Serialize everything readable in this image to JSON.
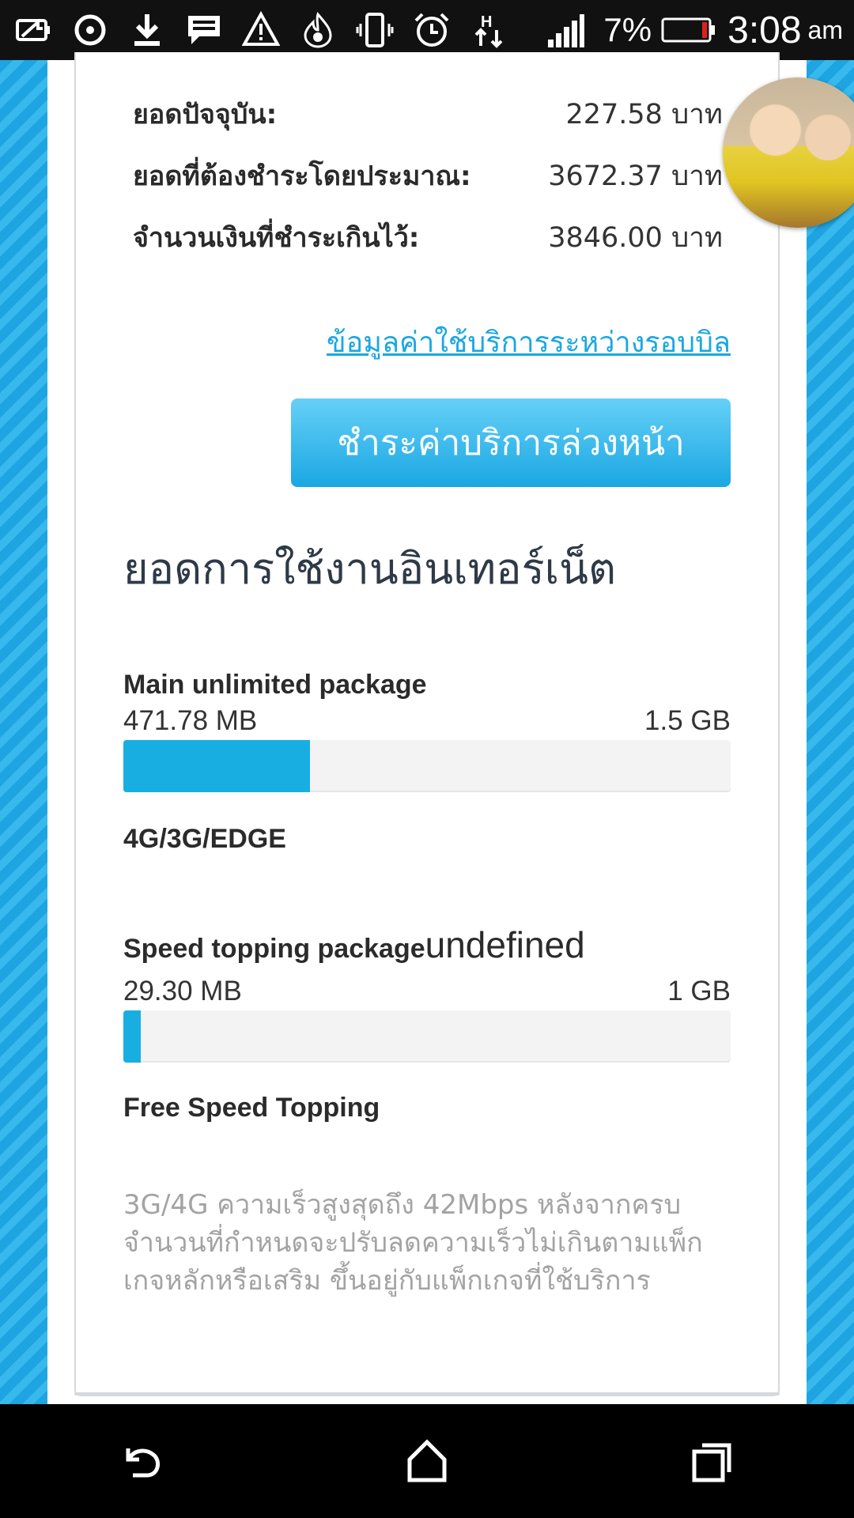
{
  "status_bar": {
    "battery_percent": "7%",
    "time": "3:08",
    "ampm": "am",
    "icons": [
      "battery-saver-icon",
      "sync-icon",
      "download-icon",
      "message-icon",
      "warning-icon",
      "flame-icon",
      "vibrate-icon",
      "alarm-icon",
      "hspa-data-icon",
      "signal-icon",
      "battery-icon"
    ]
  },
  "balances": [
    {
      "label": "ยอดปัจจุบัน:",
      "value": "227.58 บาท"
    },
    {
      "label": "ยอดที่ต้องชำระโดยประมาณ:",
      "value": "3672.37 บาท"
    },
    {
      "label": "จำนวนเงินที่ชำระเกินไว้:",
      "value": "3846.00 บาท"
    }
  ],
  "link_text": "ข้อมูลค่าใช้บริการระหว่างรอบบิล",
  "prepay_button": "ชำระค่าบริการล่วงหน้า",
  "section_title": "ยอดการใช้งานอินเทอร์เน็ต",
  "packages": [
    {
      "name": "Main unlimited package",
      "suffix": "",
      "used": "471.78 MB",
      "total": "1.5 GB",
      "fill_fraction": 0.307,
      "network": "4G/3G/EDGE"
    },
    {
      "name": "Speed topping package",
      "suffix": "undefined",
      "used": "29.30 MB",
      "total": "1 GB",
      "fill_fraction": 0.029,
      "network": "Free Speed Topping"
    }
  ],
  "note": "3G/4G ความเร็วสูงสุดถึง 42Mbps หลังจากครบจำนวนที่กำหนดจะปรับลดความเร็วไม่เกินตามแพ็กเกจหลักหรือเสริม ขึ้นอยู่กับแพ็กเกจที่ใช้บริการ",
  "colors": {
    "accent": "#1aa7e2",
    "bar_fill": "#19aee2",
    "note_text": "#a3a3a3"
  },
  "nav": [
    "back-icon",
    "home-icon",
    "recents-icon"
  ]
}
